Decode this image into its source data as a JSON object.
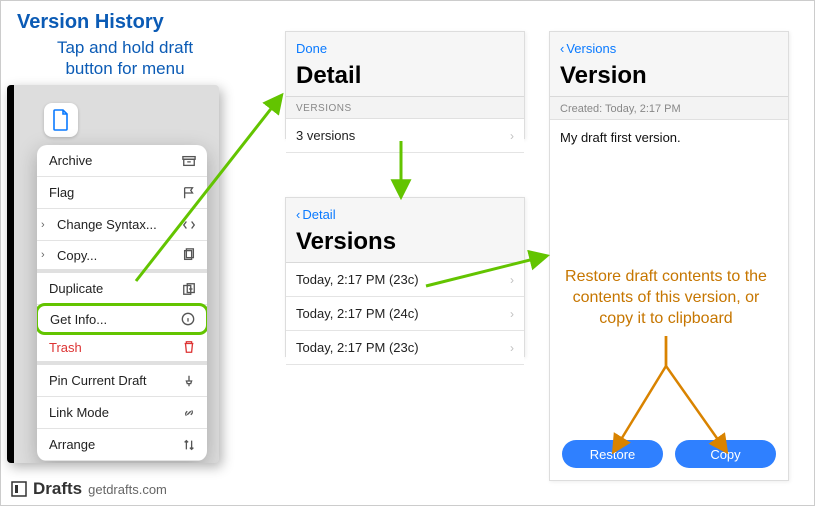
{
  "title": "Version History",
  "hint": "Tap and hold draft button for menu",
  "menu": {
    "items": [
      {
        "label": "Archive",
        "icon": "archive-icon"
      },
      {
        "label": "Flag",
        "icon": "flag-icon"
      },
      {
        "label": "Change Syntax...",
        "icon": "code-icon",
        "submenu": true
      },
      {
        "label": "Copy...",
        "icon": "copy-icon",
        "submenu": true,
        "sep": true
      },
      {
        "label": "Duplicate",
        "icon": "duplicate-icon"
      },
      {
        "label": "Get Info...",
        "icon": "info-icon",
        "highlight": true
      },
      {
        "label": "Trash",
        "icon": "trash-icon",
        "trash": true,
        "sep": true
      },
      {
        "label": "Pin Current Draft",
        "icon": "pin-icon"
      },
      {
        "label": "Link Mode",
        "icon": "link-icon"
      },
      {
        "label": "Arrange",
        "icon": "arrange-icon"
      }
    ]
  },
  "detail": {
    "done": "Done",
    "title": "Detail",
    "section": "VERSIONS",
    "row": "3 versions"
  },
  "versions": {
    "back": "Detail",
    "title": "Versions",
    "rows": [
      "Today, 2:17 PM (23c)",
      "Today, 2:17 PM (24c)",
      "Today, 2:17 PM (23c)"
    ]
  },
  "version": {
    "back": "Versions",
    "title": "Version",
    "created": "Created: Today, 2:17 PM",
    "body": "My draft first version.",
    "restore": "Restore",
    "copy": "Copy"
  },
  "annotation": "Restore draft contents to the contents of this version, or copy it to clipboard",
  "footer": {
    "brand": "Drafts",
    "url": "getdrafts.com"
  }
}
